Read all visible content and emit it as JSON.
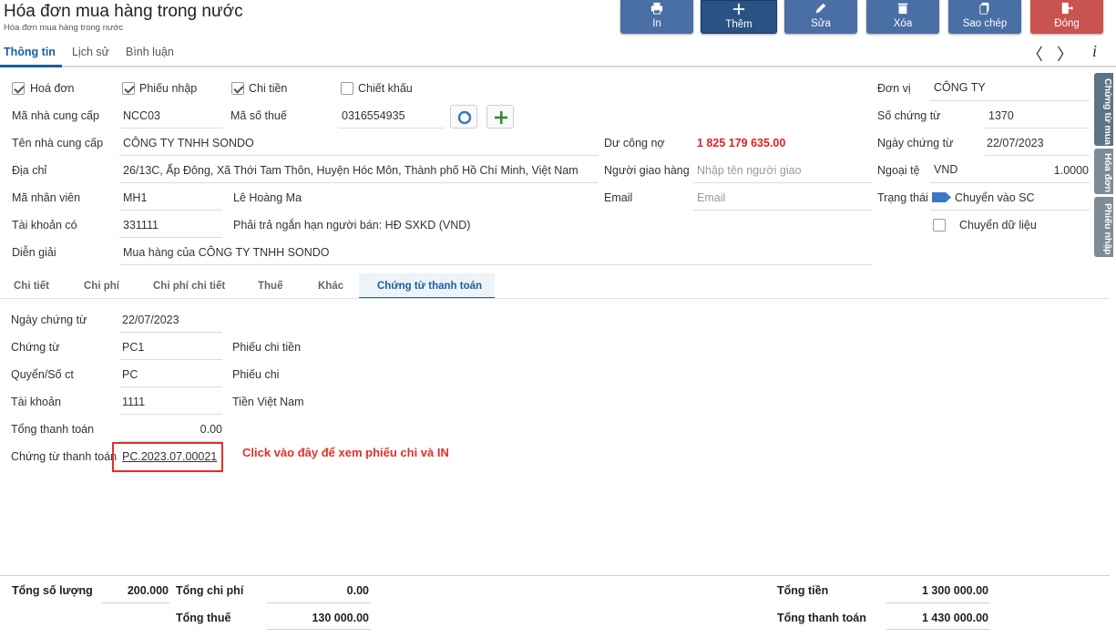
{
  "header": {
    "title": "Hóa đơn mua hàng trong nước",
    "subtitle": "Hóa đơn mua hàng trong nước"
  },
  "toolbar": {
    "print": "In",
    "add": "Thêm",
    "edit": "Sửa",
    "delete": "Xóa",
    "copy": "Sao chép",
    "close": "Đóng"
  },
  "top_tabs": {
    "info": "Thông tin",
    "history": "Lịch sử",
    "comments": "Bình luận"
  },
  "nav": {
    "prev": "〈",
    "next": "〉",
    "info": "i"
  },
  "checks": {
    "invoice": "Hoá đơn",
    "receipt": "Phiếu nhập",
    "payment": "Chi tiền",
    "discount": "Chiết khấu"
  },
  "form": {
    "supplier_code_label": "Mã nhà cung cấp",
    "supplier_code": "NCC03",
    "tax_code_label": "Mã số thuế",
    "tax_code": "0316554935",
    "supplier_name_label": "Tên nhà cung cấp",
    "supplier_name": "CÔNG TY TNHH SONDO",
    "address_label": "Địa chỉ",
    "address": "26/13C, Ấp Đông, Xã Thới Tam Thôn, Huyện Hóc Môn, Thành phố Hồ Chí Minh, Việt Nam",
    "employee_label": "Mã nhân viên",
    "employee_code": "MH1",
    "employee_name": "Lê Hoàng Ma",
    "account_label": "Tài khoản có",
    "account": "331111",
    "account_desc": "Phải trả ngắn hạn người bán: HĐ SXKD (VND)",
    "description_label": "Diễn giải",
    "description": "Mua hàng của CÔNG TY TNHH SONDO",
    "debt_label": "Dư công nợ",
    "debt": "1 825 179 635.00",
    "deliverer_label": "Người giao hàng",
    "deliverer_placeholder": "Nhập tên người giao",
    "email_label": "Email",
    "email_placeholder": "Email",
    "unit_label": "Đơn vị",
    "unit": "CÔNG TY",
    "doc_no_label": "Số chứng từ",
    "doc_no": "1370",
    "doc_date_label": "Ngày chứng từ",
    "doc_date": "22/07/2023",
    "currency_label": "Ngoại tệ",
    "currency": "VND",
    "rate": "1.0000",
    "status_label": "Trạng thái",
    "status": "Chuyển vào SC",
    "transfer_label": "Chuyển dữ liệu"
  },
  "side_tabs": {
    "purchase_doc": "Chứng từ mua",
    "invoice": "Hóa đơn",
    "receipt": "Phiếu nhập"
  },
  "sub_tabs": {
    "detail": "Chi tiết",
    "cost": "Chi phí",
    "cost_detail": "Chi phí chi tiết",
    "tax": "Thuế",
    "other": "Khác",
    "payment_doc": "Chứng từ thanh toán"
  },
  "payment": {
    "date_label": "Ngày chứng từ",
    "date": "22/07/2023",
    "doc_label": "Chứng từ",
    "doc": "PC1",
    "doc_desc": "Phiếu chi tiền",
    "book_label": "Quyển/Số ct",
    "book": "PC",
    "book_desc": "Phiếu chi",
    "account_label": "Tài khoản",
    "account": "1111",
    "account_desc": "Tiền Việt Nam",
    "total_label": "Tổng thanh toán",
    "total": "0.00",
    "voucher_label": "Chứng từ thanh toán",
    "voucher": "PC.2023.07.00021"
  },
  "annotation": "Click vào đây để xem phiếu chi và IN",
  "footer": {
    "qty_label": "Tổng số lượng",
    "qty": "200.000",
    "cost_label": "Tổng chi phí",
    "cost": "0.00",
    "tax_label": "Tổng thuế",
    "tax": "130 000.00",
    "amount_label": "Tổng tiền",
    "amount": "1 300 000.00",
    "pay_label": "Tổng thanh toán",
    "pay": "1 430 000.00"
  },
  "colors": {
    "primary": "#4a6fa5",
    "close": "#c9534f",
    "accent": "#1a5f9e",
    "alert": "#e03027"
  }
}
